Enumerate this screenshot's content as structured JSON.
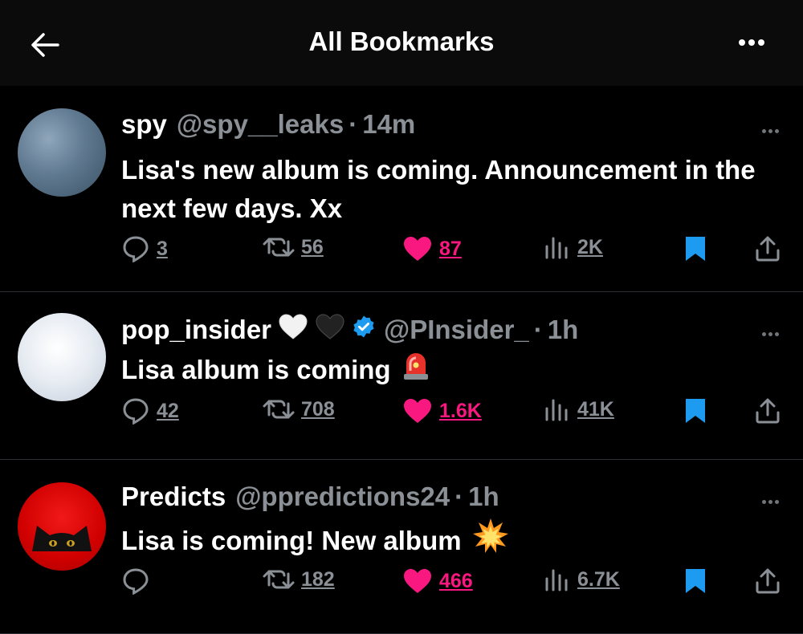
{
  "header": {
    "title": "All Bookmarks"
  },
  "tweets": [
    {
      "name": "spy",
      "handle": "@spy__leaks",
      "time": "14m",
      "text": "Lisa's new album is coming. Announcement in the next few days. Xx",
      "replies": "3",
      "retweets": "56",
      "likes": "87",
      "views": "2K"
    },
    {
      "name": "pop_insider",
      "handle": "@PInsider_",
      "time": "1h",
      "text": "Lisa album is coming",
      "replies": "42",
      "retweets": "708",
      "likes": "1.6K",
      "views": "41K"
    },
    {
      "name": "Predicts",
      "handle": "@ppredictions24",
      "time": "1h",
      "text": "Lisa is coming! New album",
      "replies": "",
      "retweets": "182",
      "likes": "466",
      "views": "6.7K"
    }
  ],
  "colors": {
    "like": "#f91880",
    "bookmark": "#1d9bf0",
    "muted": "#8b9096",
    "verified": "#1d9bf0"
  },
  "icons": [
    "back-arrow-icon",
    "more-icon",
    "reply-icon",
    "retweet-icon",
    "heart-icon",
    "views-icon",
    "bookmark-icon",
    "share-icon",
    "white-heart-emoji",
    "black-heart-emoji",
    "verified-badge-icon",
    "siren-emoji",
    "collision-emoji"
  ]
}
